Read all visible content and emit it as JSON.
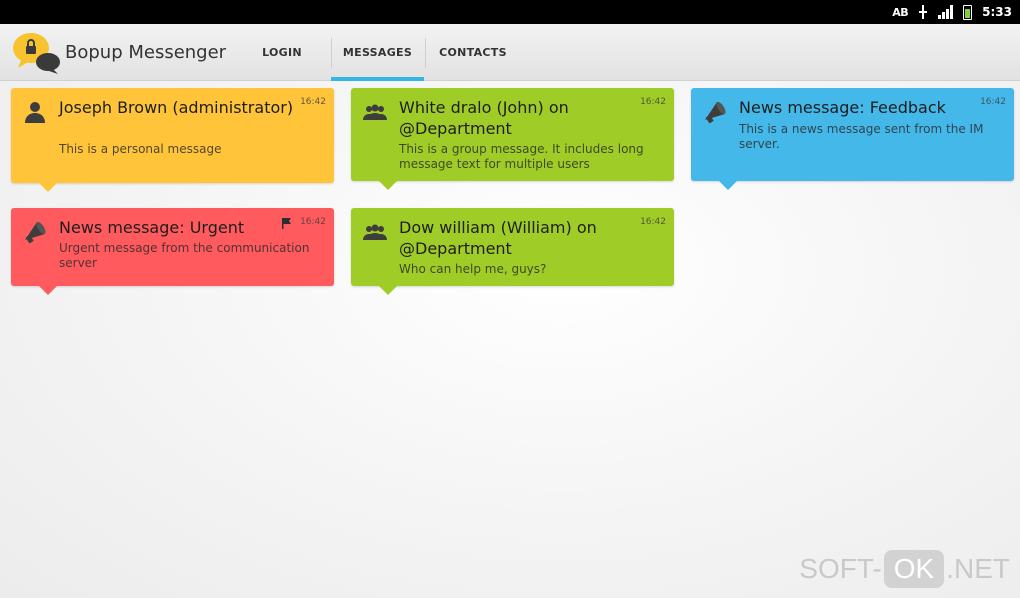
{
  "statusbar": {
    "ab_label": "AB",
    "time": "5:33",
    "icons": [
      "usb-icon",
      "signal-icon",
      "battery-icon"
    ]
  },
  "app": {
    "title": "Bopup Messenger",
    "logo": "bopup-logo-icon"
  },
  "tabs": [
    {
      "label": "LOGIN",
      "active": false
    },
    {
      "label": "MESSAGES",
      "active": true
    },
    {
      "label": "CONTACTS",
      "active": false
    }
  ],
  "colors": {
    "accent": "#33b5e5",
    "personal": "#ffc43a",
    "group": "#9fcc26",
    "news": "#45b8ea",
    "urgent": "#ff5a5e"
  },
  "messages": [
    {
      "icon": "person-icon",
      "title": "Joseph Brown (administrator)",
      "text": "This is a personal message",
      "time": "16:42"
    },
    {
      "icon": "group-icon",
      "title": "White dralo (John) on @Department",
      "text": "This is a group message. It includes long message text for multiple users",
      "time": "16:42"
    },
    {
      "icon": "megaphone-icon",
      "title": "News message: Feedback",
      "text": "This is a news message sent from the IM server.",
      "time": "16:42"
    },
    {
      "icon": "megaphone-icon",
      "title": "News message: Urgent",
      "text": "Urgent message from the communication server",
      "time": "16:42",
      "flagged": true
    },
    {
      "icon": "group-icon",
      "title": "Dow william (William) on @Department",
      "text": "Who can help me, guys?",
      "time": "16:42"
    }
  ],
  "watermark": {
    "left": "SOFT-",
    "box": "OK",
    "right": ".NET"
  }
}
